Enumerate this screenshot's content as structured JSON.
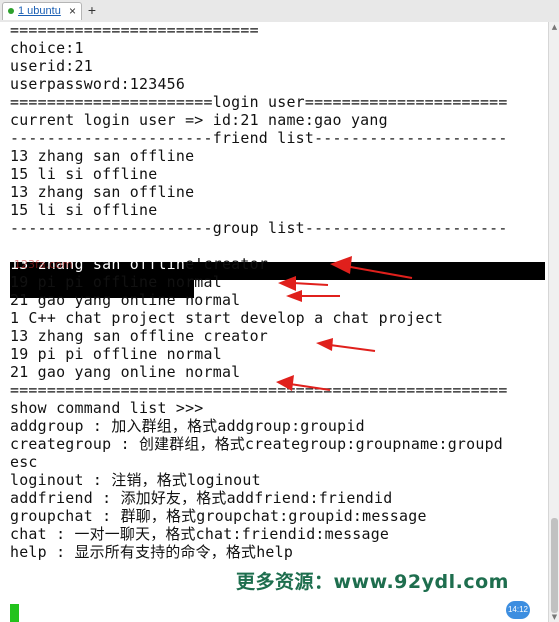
{
  "tab": {
    "label": "1 ubuntu",
    "close_glyph": "×",
    "new_glyph": "+"
  },
  "terminal": {
    "lines": [
      "===========================",
      "choice:1",
      "userid:21",
      "userpassword:123456",
      "======================login user======================",
      "current login user => id:21 name:gao yang",
      "----------------------friend list---------------------",
      "13 zhang san offline",
      "15 li si offline",
      "13 zhang san offline",
      "15 li si offline",
      "----------------------group list----------------------",
      "1 C++ chat project start develop a chat project",
      "13 zhang san offline creator",
      "19 pi pi offline normal",
      "21 gao yang online normal",
      "1 C++ chat project start develop a chat project",
      "13 zhang san offline creator",
      "19 pi pi offline normal",
      "21 gao yang online normal",
      "======================================================",
      "show command list >>>",
      "addgroup : 加入群组，格式addgroup:groupid",
      "creategroup : 创建群组，格式creategroup:groupname:groupd",
      "esc",
      "loginout : 注销，格式loginout",
      "addfriend : 添加好友，格式addfriend:friendid",
      "groupchat : 群聊，格式groupchat:groupid:message",
      "chat : 一对一聊天，格式chat:friendid:message",
      "help : 显示所有支持的命令，格式help"
    ]
  },
  "overlay": {
    "watermark": "更多资源：www.92ydl.com",
    "faint_watermark": "123fa.com",
    "clock_badge": "14:12"
  },
  "colors": {
    "arrow": "#e0201c",
    "cursor": "#22c31c",
    "tab_accent": "#1a5fb4"
  }
}
